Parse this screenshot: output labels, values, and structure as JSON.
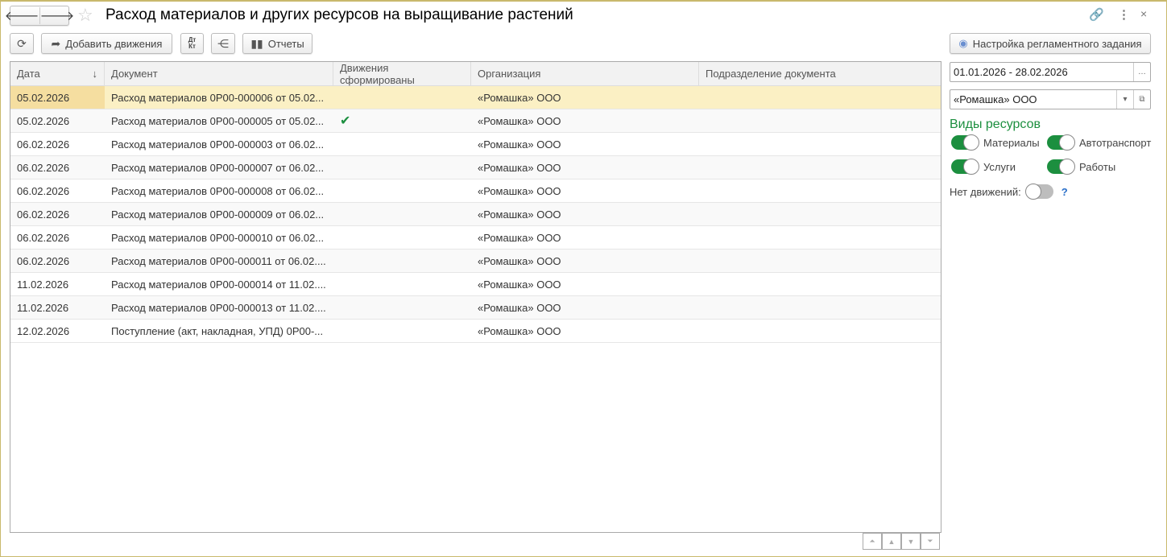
{
  "window": {
    "title": "Расход материалов и других ресурсов на выращивание растений"
  },
  "toolbar": {
    "add_moves": "Добавить движения",
    "dtkt": "Дт Кт",
    "reports": "Отчеты",
    "schedule": "Настройка регламентного задания"
  },
  "table": {
    "columns": [
      "Дата",
      "Документ",
      "Движения сформированы",
      "Организация",
      "Подразделение документа"
    ],
    "rows": [
      {
        "date": "05.02.2026",
        "doc": "Расход материалов 0Р00-000006 от 05.02...",
        "moves": "",
        "org": "«Ромашка» ООО",
        "dept": ""
      },
      {
        "date": "05.02.2026",
        "doc": "Расход материалов 0Р00-000005 от 05.02...",
        "moves": "✔",
        "org": "«Ромашка» ООО",
        "dept": ""
      },
      {
        "date": "06.02.2026",
        "doc": "Расход материалов 0Р00-000003 от 06.02...",
        "moves": "",
        "org": "«Ромашка» ООО",
        "dept": ""
      },
      {
        "date": "06.02.2026",
        "doc": "Расход материалов 0Р00-000007 от 06.02...",
        "moves": "",
        "org": "«Ромашка» ООО",
        "dept": ""
      },
      {
        "date": "06.02.2026",
        "doc": "Расход материалов 0Р00-000008 от 06.02...",
        "moves": "",
        "org": "«Ромашка» ООО",
        "dept": ""
      },
      {
        "date": "06.02.2026",
        "doc": "Расход материалов 0Р00-000009 от 06.02...",
        "moves": "",
        "org": "«Ромашка» ООО",
        "dept": ""
      },
      {
        "date": "06.02.2026",
        "doc": "Расход материалов 0Р00-000010 от 06.02...",
        "moves": "",
        "org": "«Ромашка» ООО",
        "dept": ""
      },
      {
        "date": "06.02.2026",
        "doc": "Расход материалов 0Р00-000011 от 06.02....",
        "moves": "",
        "org": "«Ромашка» ООО",
        "dept": ""
      },
      {
        "date": "11.02.2026",
        "doc": "Расход материалов 0Р00-000014 от 11.02....",
        "moves": "",
        "org": "«Ромашка» ООО",
        "dept": ""
      },
      {
        "date": "11.02.2026",
        "doc": "Расход материалов 0Р00-000013 от 11.02....",
        "moves": "",
        "org": "«Ромашка» ООО",
        "dept": ""
      },
      {
        "date": "12.02.2026",
        "doc": "Поступление (акт, накладная, УПД) 0Р00-...",
        "moves": "",
        "org": "«Ромашка» ООО",
        "dept": ""
      }
    ]
  },
  "filters": {
    "period": "01.01.2026 - 28.02.2026",
    "org": "«Ромашка» ООО",
    "section": "Виды ресурсов",
    "toggles": [
      {
        "label": "Материалы",
        "on": true
      },
      {
        "label": "Автотранспорт",
        "on": true
      },
      {
        "label": "Услуги",
        "on": true
      },
      {
        "label": "Работы",
        "on": true
      }
    ],
    "no_moves_label": "Нет движений:",
    "no_moves_on": false,
    "help": "?"
  },
  "colors": {
    "accent": "#1c8f3f",
    "selected_row": "#fbf0c4"
  }
}
